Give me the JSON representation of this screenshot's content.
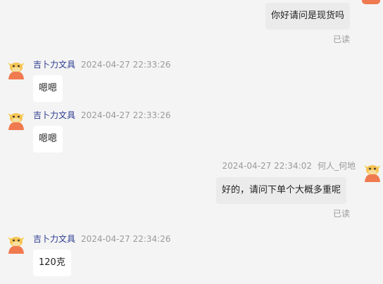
{
  "conversation": {
    "messages": [
      {
        "direction": "outgoing",
        "text": "你好请问是现货吗",
        "status": "已读"
      },
      {
        "direction": "incoming",
        "sender": "吉卜力文具",
        "timestamp": "2024-04-27 22:33:26",
        "text": "嗯嗯"
      },
      {
        "direction": "incoming",
        "sender": "吉卜力文具",
        "timestamp": "2024-04-27 22:33:26",
        "text": "嗯嗯"
      },
      {
        "direction": "outgoing",
        "sender": "何人_何地",
        "timestamp": "2024-04-27 22:34:02",
        "text": "好的，请问下单个大概多重呢",
        "status": "已读"
      },
      {
        "direction": "incoming",
        "sender": "吉卜力文具",
        "timestamp": "2024-04-27 22:34:26",
        "text": "120克"
      }
    ]
  },
  "icons": {
    "avatar": "cartoon-cow-avatar-icon"
  },
  "colors": {
    "background": "#f4f4f4",
    "incoming_bubble": "#ffffff",
    "outgoing_bubble": "#ebebeb",
    "sender_name": "#2b3a8f",
    "timestamp": "#9a9a9a",
    "avatar_orange": "#f07a4f"
  }
}
